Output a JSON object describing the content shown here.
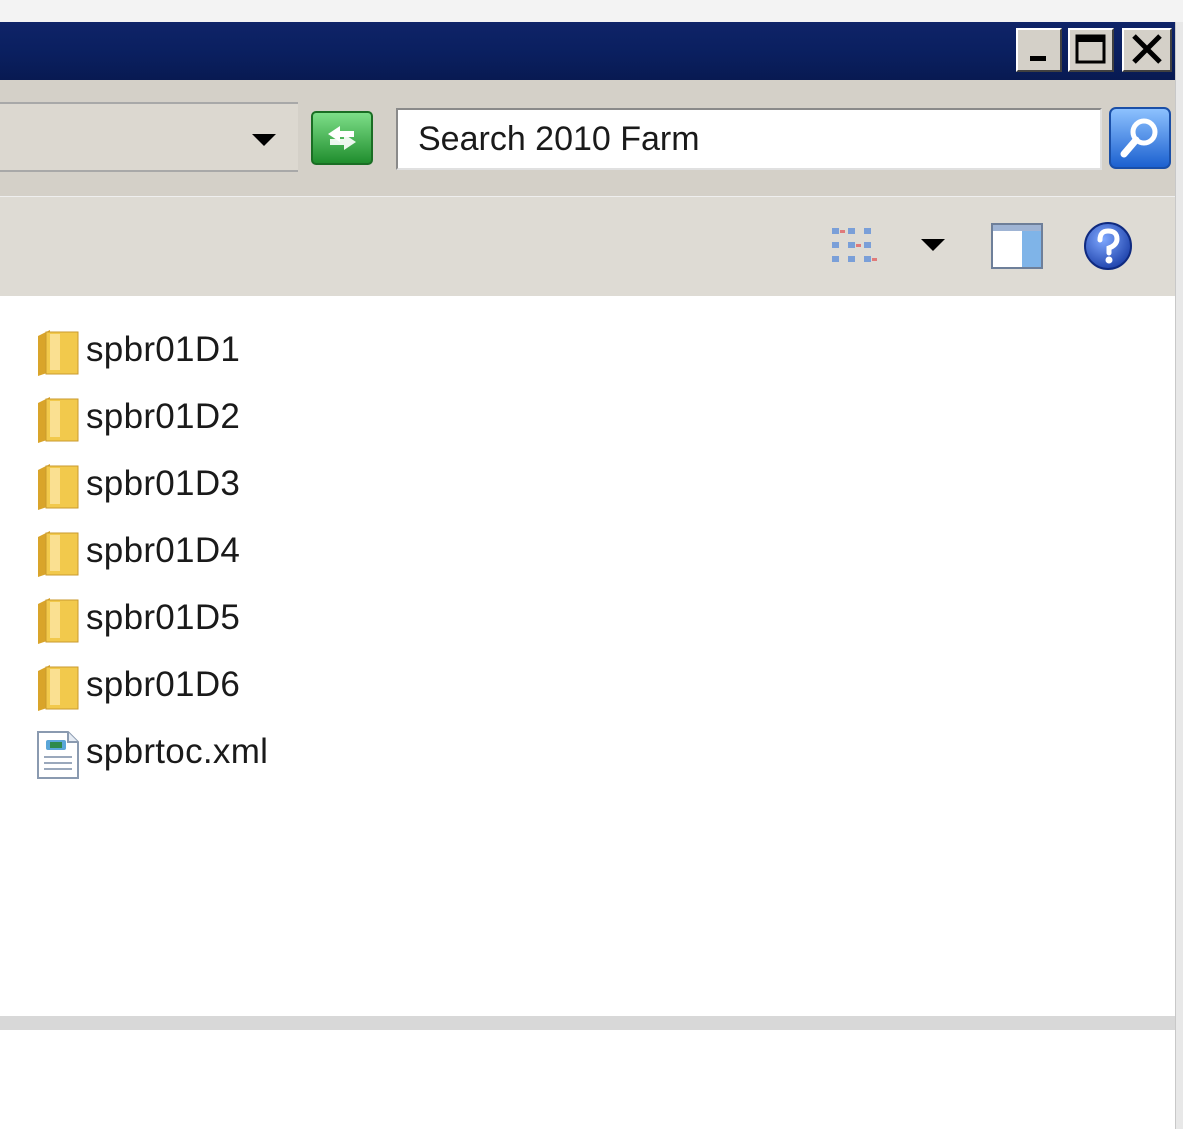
{
  "window": {
    "minimize_icon": "minimize-icon",
    "maximize_icon": "maximize-icon",
    "close_icon": "close-icon"
  },
  "address_bar": {
    "dropdown_icon": "chevron-down-icon",
    "go_icon": "refresh-arrows-icon",
    "go_color": "#2ea043"
  },
  "search": {
    "placeholder": "Search 2010 Farm",
    "button_icon": "search-icon"
  },
  "toolbar": {
    "views_icon": "views-icon",
    "views_dropdown_icon": "chevron-down-icon",
    "preview_pane_icon": "preview-pane-icon",
    "help_icon": "help-icon"
  },
  "files": [
    {
      "name": "spbr01D1",
      "type": "folder"
    },
    {
      "name": "spbr01D2",
      "type": "folder"
    },
    {
      "name": "spbr01D3",
      "type": "folder"
    },
    {
      "name": "spbr01D4",
      "type": "folder"
    },
    {
      "name": "spbr01D5",
      "type": "folder"
    },
    {
      "name": "spbr01D6",
      "type": "folder"
    },
    {
      "name": "spbrtoc.xml",
      "type": "xml-file"
    }
  ],
  "colors": {
    "title_bar": "#0a1f5f",
    "chrome": "#d4d0c8",
    "folder": "#f2c94c"
  }
}
